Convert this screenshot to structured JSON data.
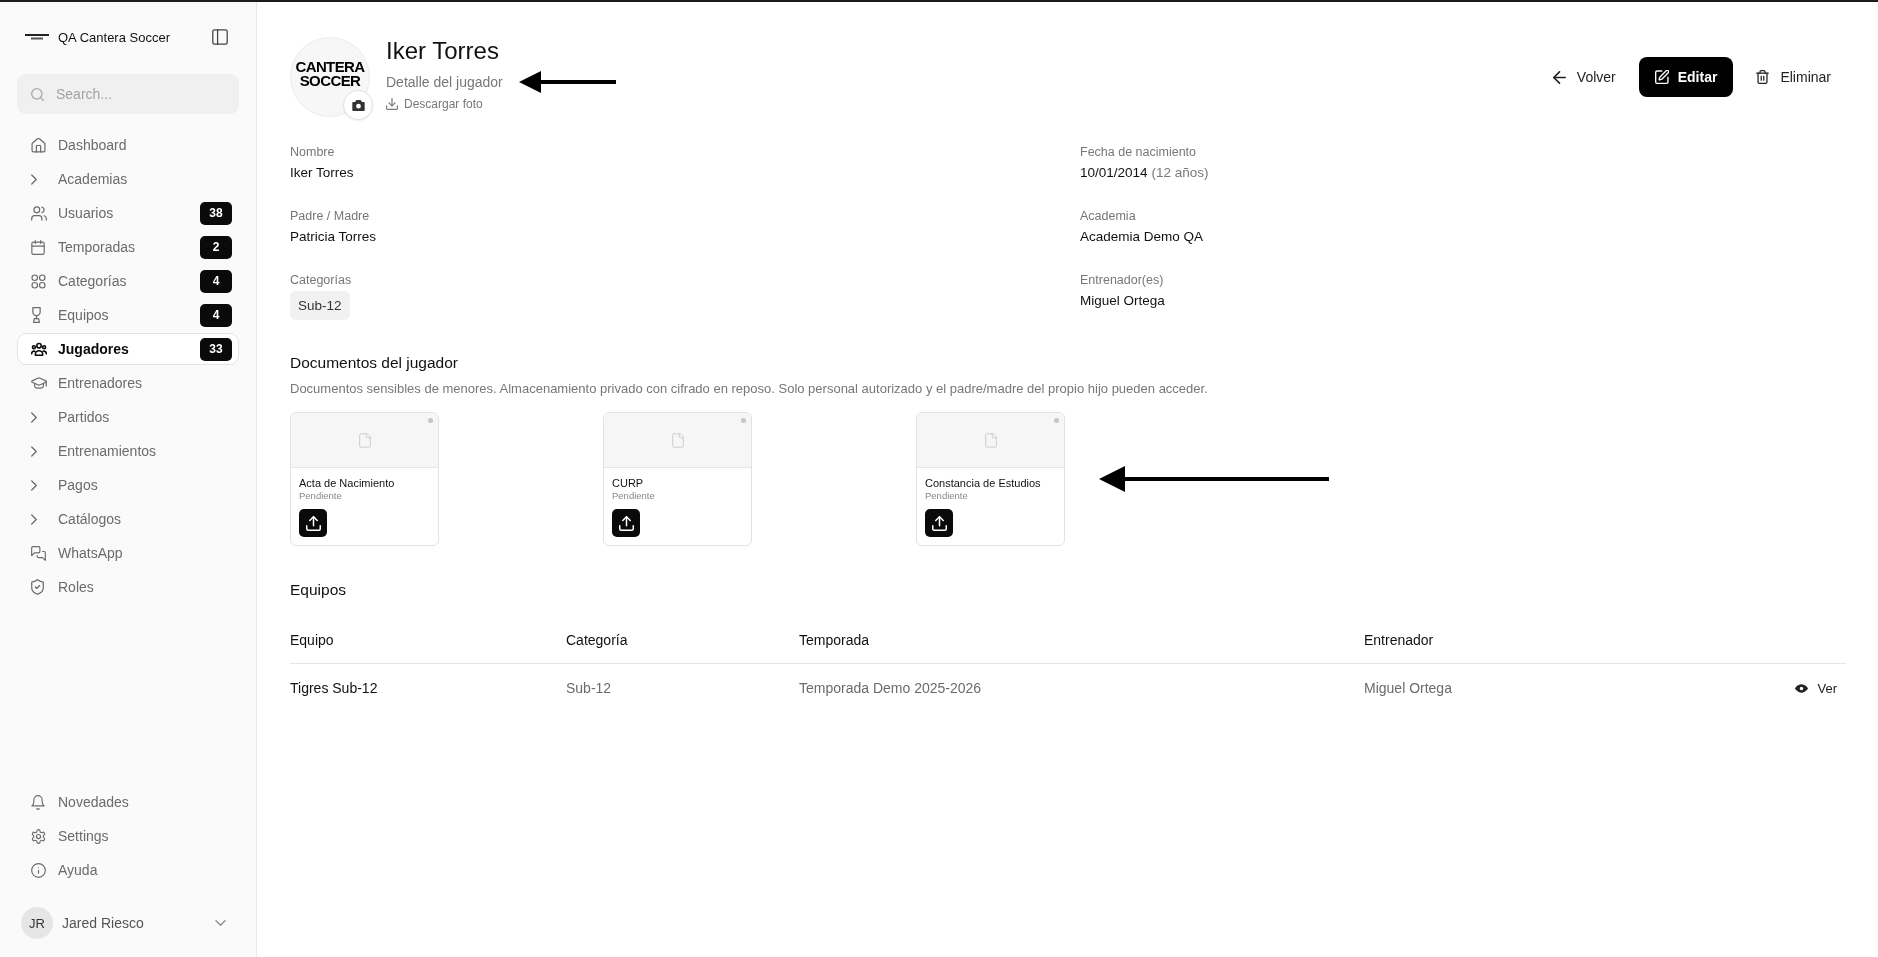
{
  "sidebar": {
    "brand": {
      "name": "QA Cantera Soccer"
    },
    "search": {
      "placeholder": "Search..."
    },
    "nav": [
      {
        "label": "Dashboard",
        "kind": "link",
        "selected": false
      },
      {
        "label": "Academias",
        "kind": "group",
        "selected": false
      },
      {
        "label": "Usuarios",
        "kind": "link",
        "badge": "38",
        "selected": false
      },
      {
        "label": "Temporadas",
        "kind": "link",
        "badge": "2",
        "selected": false
      },
      {
        "label": "Categorías",
        "kind": "link",
        "badge": "4",
        "selected": false
      },
      {
        "label": "Equipos",
        "kind": "link",
        "badge": "4",
        "selected": false
      },
      {
        "label": "Jugadores",
        "kind": "link",
        "badge": "33",
        "selected": true
      },
      {
        "label": "Entrenadores",
        "kind": "link",
        "selected": false
      },
      {
        "label": "Partidos",
        "kind": "group",
        "selected": false
      },
      {
        "label": "Entrenamientos",
        "kind": "group",
        "selected": false
      },
      {
        "label": "Pagos",
        "kind": "group",
        "selected": false
      },
      {
        "label": "Catálogos",
        "kind": "group",
        "selected": false
      },
      {
        "label": "WhatsApp",
        "kind": "link",
        "selected": false
      },
      {
        "label": "Roles",
        "kind": "link",
        "selected": false
      }
    ],
    "footer_nav": [
      {
        "label": "Novedades",
        "selected": false
      },
      {
        "label": "Settings",
        "selected": false
      },
      {
        "label": "Ayuda",
        "selected": false
      }
    ],
    "user": {
      "initials": "JR",
      "name": "Jared Riesco"
    }
  },
  "profile": {
    "logo_lines": [
      "CANTERA",
      "SOCCER"
    ],
    "name": "Iker Torres",
    "subtitle": "Detalle del jugador",
    "download_label": "Descargar foto"
  },
  "actions": [
    {
      "label": "Volver",
      "kind": "back"
    },
    {
      "label": "Editar",
      "kind": "primary"
    },
    {
      "label": "Eliminar",
      "kind": "delete"
    }
  ],
  "details": [
    {
      "label": "Nombre",
      "value": "Iker Torres"
    },
    {
      "label": "Fecha de nacimiento",
      "value": "10/01/2014",
      "note": "(12 años)"
    },
    {
      "label": "Padre / Madre",
      "value": "Patricia Torres"
    },
    {
      "label": "Academia",
      "value": "Academia Demo QA"
    },
    {
      "label": "Categorías",
      "chips": [
        "Sub-12"
      ]
    },
    {
      "label": "Entrenador(es)",
      "value": "Miguel Ortega"
    }
  ],
  "documents": {
    "title": "Documentos del jugador",
    "description": "Documentos sensibles de menores. Almacenamiento privado con cifrado en reposo. Solo personal autorizado y el padre/madre del propio hijo pueden acceder.",
    "items": [
      {
        "name": "Acta de Nacimiento",
        "status": "Pendiente"
      },
      {
        "name": "CURP",
        "status": "Pendiente"
      },
      {
        "name": "Constancia de Estudios",
        "status": "Pendiente"
      }
    ]
  },
  "teams": {
    "title": "Equipos",
    "columns": [
      "Equipo",
      "Categoría",
      "Temporada",
      "Entrenador"
    ],
    "rows": [
      {
        "cells": [
          "Tigres Sub-12",
          "Sub-12",
          "Temporada Demo 2025-2026",
          "Miguel Ortega"
        ],
        "action": "Ver"
      }
    ]
  }
}
